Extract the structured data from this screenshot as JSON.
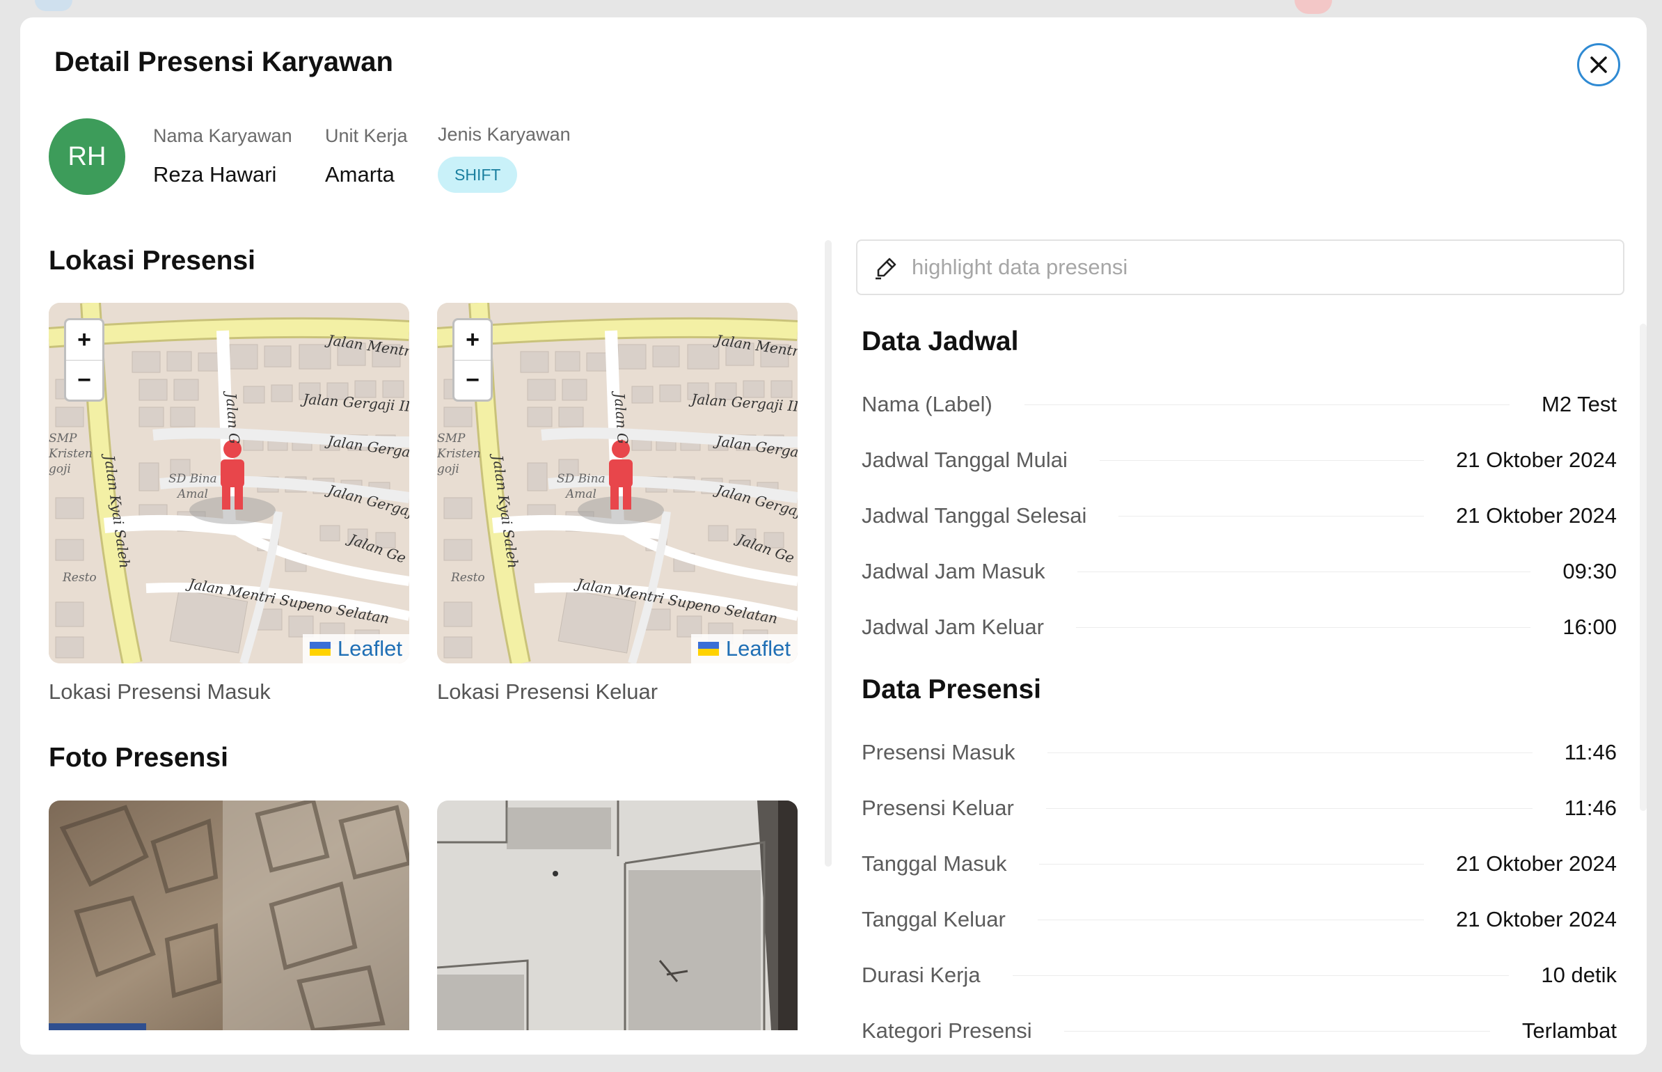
{
  "modal": {
    "title": "Detail Presensi Karyawan"
  },
  "employee": {
    "initials": "RH",
    "name_label": "Nama Karyawan",
    "name": "Reza Hawari",
    "unit_label": "Unit Kerja",
    "unit": "Amarta",
    "type_label": "Jenis Karyawan",
    "type": "SHIFT"
  },
  "location": {
    "title": "Lokasi Presensi",
    "zoom_in": "+",
    "zoom_out": "−",
    "attribution": "Leaflet",
    "street_labels": [
      "Jalan Mentr",
      "Jalan Gergaji II",
      "Jalan Gerga",
      "Jalan Gergaj",
      "Jalan Ge",
      "Jalan Kyai Saleh",
      "Jalan G",
      "Jalan Mentri Supeno Selatan",
      "SMP",
      "Kristen",
      "goji",
      "SD Bina",
      "Amal",
      "Resto"
    ],
    "caption_in": "Lokasi Presensi Masuk",
    "caption_out": "Lokasi Presensi Keluar"
  },
  "photos": {
    "title": "Foto Presensi"
  },
  "search": {
    "placeholder": "highlight data presensi"
  },
  "schedule": {
    "title": "Data Jadwal",
    "rows": [
      {
        "label": "Nama (Label)",
        "value": "M2 Test"
      },
      {
        "label": "Jadwal Tanggal Mulai",
        "value": "21 Oktober 2024"
      },
      {
        "label": "Jadwal Tanggal Selesai",
        "value": "21 Oktober 2024"
      },
      {
        "label": "Jadwal Jam Masuk",
        "value": "09:30"
      },
      {
        "label": "Jadwal Jam Keluar",
        "value": "16:00"
      }
    ]
  },
  "attendance": {
    "title": "Data Presensi",
    "rows": [
      {
        "label": "Presensi Masuk",
        "value": "11:46"
      },
      {
        "label": "Presensi Keluar",
        "value": "11:46"
      },
      {
        "label": "Tanggal Masuk",
        "value": "21 Oktober 2024"
      },
      {
        "label": "Tanggal Keluar",
        "value": "21 Oktober 2024"
      },
      {
        "label": "Durasi Kerja",
        "value": "10 detik"
      },
      {
        "label": "Kategori Presensi",
        "value": "Terlambat"
      }
    ]
  },
  "colors": {
    "avatar": "#3d9c5a",
    "badge_bg": "#c9f1f9",
    "close_border": "#2f8ad3",
    "map_marker": "#e8464b"
  },
  "icons": {
    "close": "close-icon",
    "pen": "highlighter-icon",
    "marker": "person-marker-icon",
    "flag": "ukraine-flag-icon"
  }
}
